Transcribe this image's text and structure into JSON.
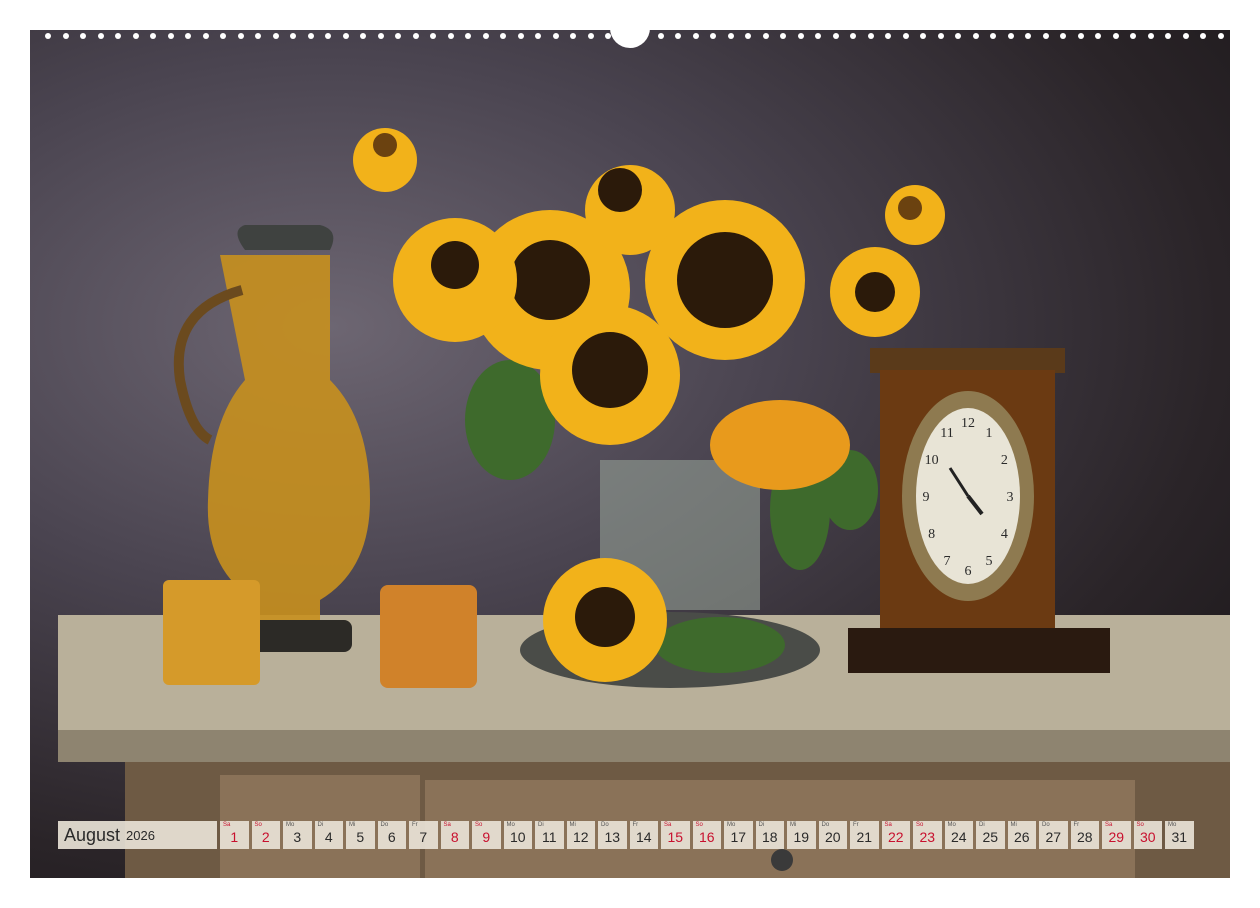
{
  "calendar": {
    "month": "August",
    "year": "2026",
    "days": [
      {
        "wd": "Sa",
        "d": "1",
        "red": true
      },
      {
        "wd": "So",
        "d": "2",
        "red": true
      },
      {
        "wd": "Mo",
        "d": "3",
        "red": false
      },
      {
        "wd": "Di",
        "d": "4",
        "red": false
      },
      {
        "wd": "Mi",
        "d": "5",
        "red": false
      },
      {
        "wd": "Do",
        "d": "6",
        "red": false
      },
      {
        "wd": "Fr",
        "d": "7",
        "red": false
      },
      {
        "wd": "Sa",
        "d": "8",
        "red": true
      },
      {
        "wd": "So",
        "d": "9",
        "red": true
      },
      {
        "wd": "Mo",
        "d": "10",
        "red": false
      },
      {
        "wd": "Di",
        "d": "11",
        "red": false
      },
      {
        "wd": "Mi",
        "d": "12",
        "red": false
      },
      {
        "wd": "Do",
        "d": "13",
        "red": false
      },
      {
        "wd": "Fr",
        "d": "14",
        "red": false
      },
      {
        "wd": "Sa",
        "d": "15",
        "red": true
      },
      {
        "wd": "So",
        "d": "16",
        "red": true
      },
      {
        "wd": "Mo",
        "d": "17",
        "red": false
      },
      {
        "wd": "Di",
        "d": "18",
        "red": false
      },
      {
        "wd": "Mi",
        "d": "19",
        "red": false
      },
      {
        "wd": "Do",
        "d": "20",
        "red": false
      },
      {
        "wd": "Fr",
        "d": "21",
        "red": false
      },
      {
        "wd": "Sa",
        "d": "22",
        "red": true
      },
      {
        "wd": "So",
        "d": "23",
        "red": true
      },
      {
        "wd": "Mo",
        "d": "24",
        "red": false
      },
      {
        "wd": "Di",
        "d": "25",
        "red": false
      },
      {
        "wd": "Mi",
        "d": "26",
        "red": false
      },
      {
        "wd": "Do",
        "d": "27",
        "red": false
      },
      {
        "wd": "Fr",
        "d": "28",
        "red": false
      },
      {
        "wd": "Sa",
        "d": "29",
        "red": true
      },
      {
        "wd": "So",
        "d": "30",
        "red": true
      },
      {
        "wd": "Mo",
        "d": "31",
        "red": false
      }
    ]
  },
  "clock": {
    "numerals": [
      "12",
      "1",
      "2",
      "3",
      "4",
      "5",
      "6",
      "7",
      "8",
      "9",
      "10",
      "11"
    ]
  },
  "colors": {
    "weekend": "#c8102e",
    "sunflower": "#f2b21a",
    "amber_glass": "#c8901e"
  }
}
